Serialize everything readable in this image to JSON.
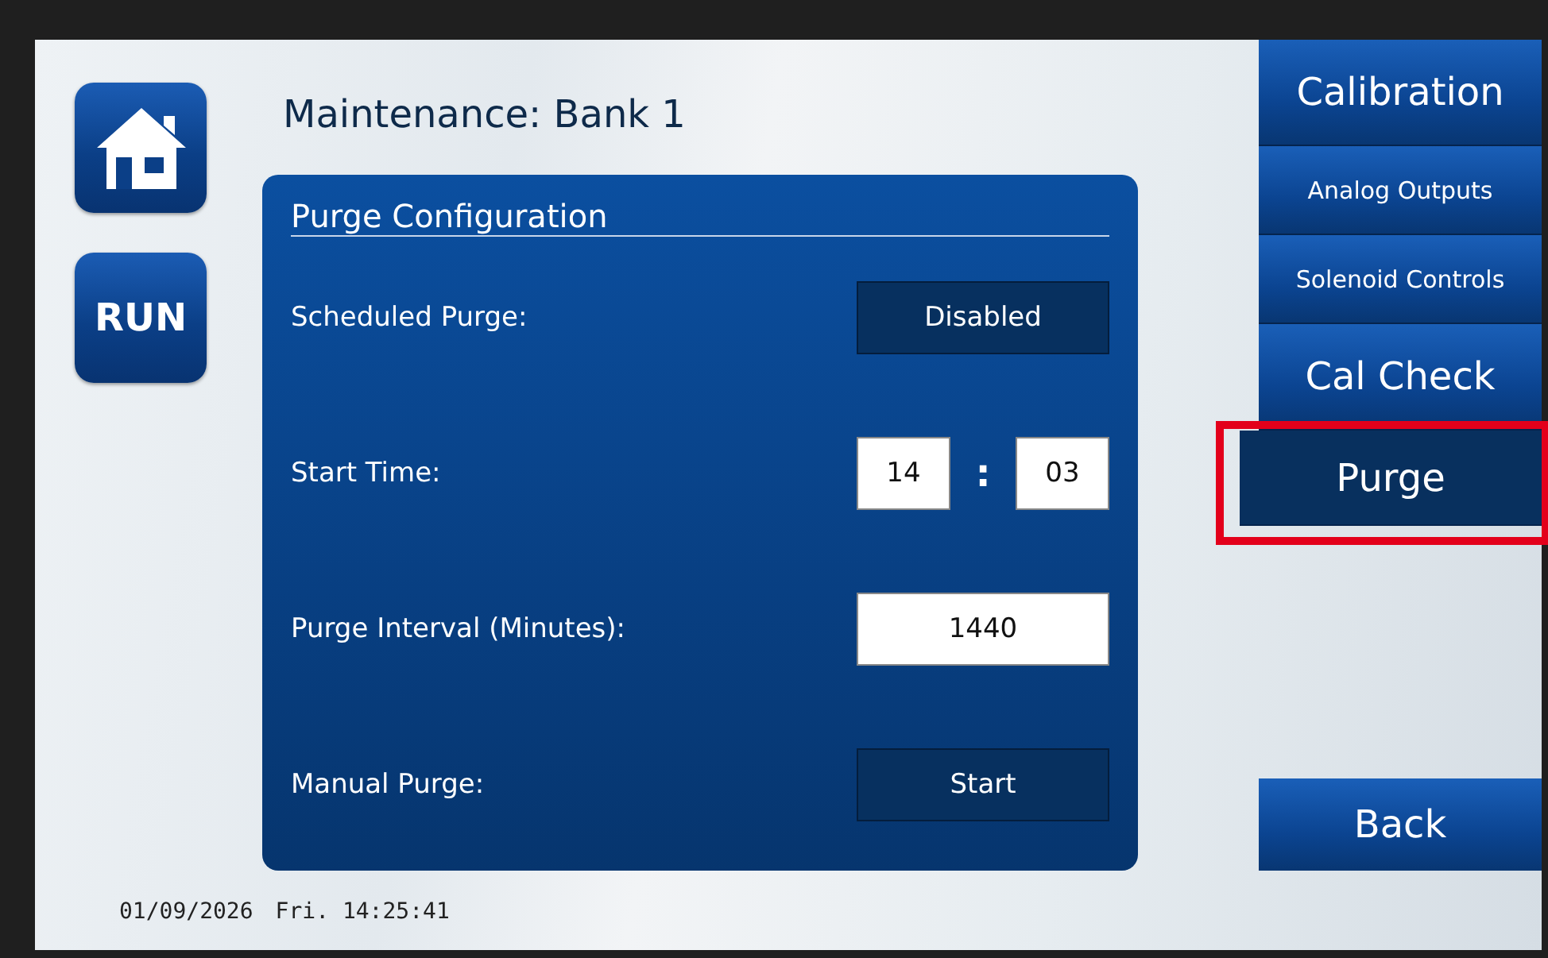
{
  "title": "Maintenance: Bank 1",
  "nav_left": [
    {
      "kind": "home"
    },
    {
      "kind": "run",
      "label": "RUN"
    }
  ],
  "panel": {
    "title": "Purge Configuration",
    "rows": [
      {
        "kind": "button",
        "label": "Scheduled Purge:",
        "value": "Disabled"
      },
      {
        "kind": "time",
        "label": "Start Time:",
        "hours": "14",
        "separator": ":",
        "minutes": "03"
      },
      {
        "kind": "field",
        "label": "Purge Interval (Minutes):",
        "value": "1440"
      },
      {
        "kind": "button",
        "label": "Manual Purge:",
        "value": "Start"
      }
    ]
  },
  "menu": [
    {
      "kind": "large",
      "label": "Calibration",
      "selected": false
    },
    {
      "kind": "small",
      "label": "Analog Outputs",
      "selected": false
    },
    {
      "kind": "small",
      "label": "Solenoid Controls",
      "selected": false
    },
    {
      "kind": "large",
      "label": "Cal Check",
      "selected": false
    },
    {
      "kind": "large",
      "label": "Purge",
      "selected": true
    }
  ],
  "back": "Back",
  "status_bar": {
    "date": "01/09/2026",
    "time": "Fri. 14:25:41"
  }
}
